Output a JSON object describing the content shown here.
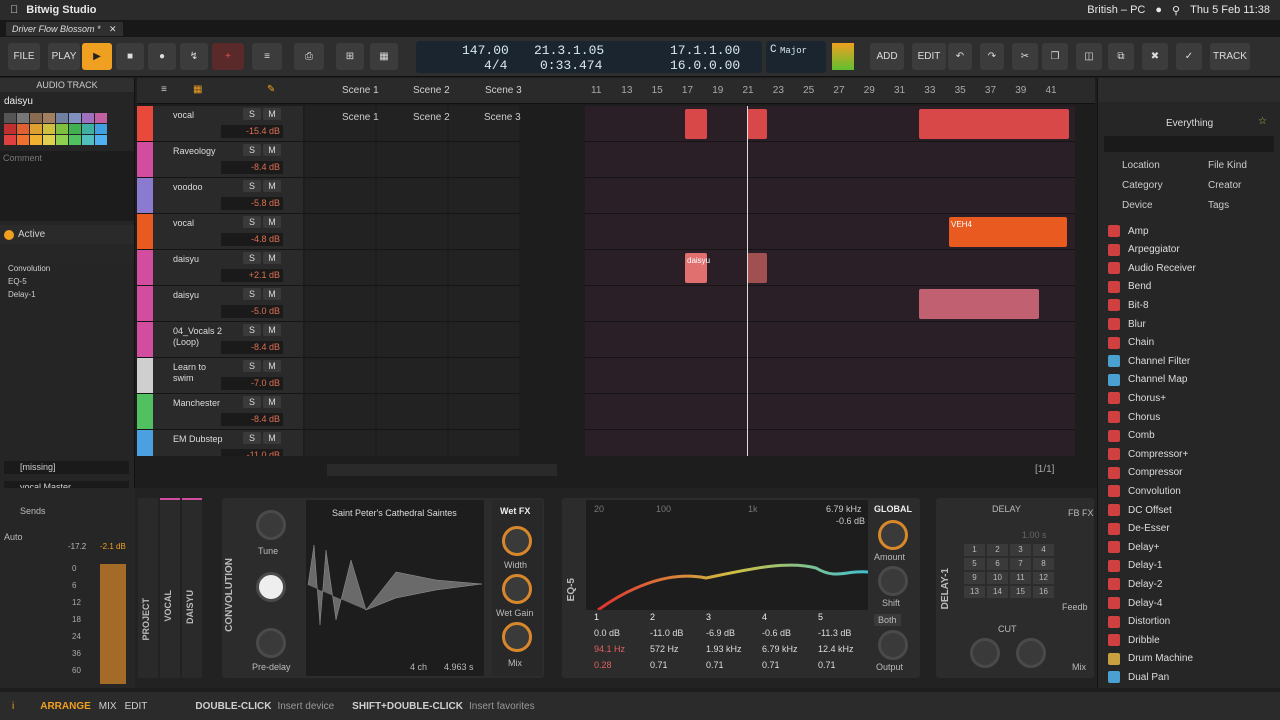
{
  "menubar": {
    "app": "Bitwig Studio",
    "keyboard": "British – PC",
    "clock": "Thu 5 Feb  11:38"
  },
  "tab": {
    "title": "Driver Flow Blossom *"
  },
  "transport": {
    "file": "FILE",
    "play": "PLAY",
    "tempo": "147.00",
    "signature": "4/4",
    "position": "21.3.1.05",
    "time": "0:33.474",
    "loop_start": "17.1.1.00",
    "loop_len": "16.0.0.00",
    "key": "C",
    "scale": "Major",
    "add": "ADD",
    "edit": "EDIT",
    "track": "TRACK"
  },
  "inspector": {
    "title": "AUDIO TRACK",
    "track_name": "daisyu",
    "comment": "Comment",
    "active": "Active",
    "devices": [
      "Convolution",
      "EQ-5",
      "Delay-1"
    ],
    "input": "[missing]",
    "output": "vocal Master",
    "sends": "Sends",
    "auto": "Auto",
    "fader_db": [
      "-17.2",
      "-2.1 dB"
    ],
    "meter_scale": [
      "0",
      "6",
      "12",
      "18",
      "24",
      "36",
      "60"
    ],
    "track_labels": [
      "PROJECT",
      "VOCAL",
      "DAISYU"
    ]
  },
  "scenes": [
    "Scene 1",
    "Scene 2",
    "Scene 3"
  ],
  "ruler": [
    "11",
    "13",
    "15",
    "17",
    "19",
    "21",
    "23",
    "25",
    "27",
    "29",
    "31",
    "33",
    "35",
    "37",
    "39",
    "41"
  ],
  "tracks": [
    {
      "name": "vocal",
      "db": "-15.4 dB",
      "color": "#e8493a"
    },
    {
      "name": "Raveology",
      "db": "-8.4 dB",
      "color": "#d24da0"
    },
    {
      "name": "voodoo",
      "db": "-5.8 dB",
      "color": "#8a7ad0"
    },
    {
      "name": "vocal",
      "db": "-4.8 dB",
      "color": "#e85a20"
    },
    {
      "name": "daisyu",
      "db": "+2.1 dB",
      "color": "#d24da0"
    },
    {
      "name": "daisyu",
      "db": "-5.0 dB",
      "color": "#d24da0"
    },
    {
      "name": "04_Vocals 2 (Loop)",
      "db": "-8.4 dB",
      "color": "#d24da0"
    },
    {
      "name": "Learn to swim",
      "db": "-7.0 dB",
      "color": "#cfcfcf"
    },
    {
      "name": "Manchester",
      "db": "-8.4 dB",
      "color": "#50c060"
    },
    {
      "name": "EM Dubstep",
      "db": "-11.0 dB",
      "color": "#4aa0e0"
    }
  ],
  "clip_labels": {
    "daisyu": "daisyu",
    "veh": "VEH4"
  },
  "pager": "[1/1]",
  "convolution": {
    "title": "CONVOLUTION",
    "ir": "Saint Peter's Cathedral Saintes",
    "tune": "Tune",
    "predelay": "Pre-delay",
    "channels": "4 ch",
    "length": "4.963 s",
    "wetfx": "Wet FX",
    "width": "Width",
    "wetgain": "Wet Gain",
    "mix": "Mix"
  },
  "eq": {
    "title": "EQ-5",
    "freq_labels": [
      "20",
      "100",
      "1k"
    ],
    "readout": [
      "6.79 kHz",
      "-0.6 dB"
    ],
    "global": "GLOBAL",
    "amount": "Amount",
    "shift": "Shift",
    "both": "Both",
    "output": "Output",
    "gains": [
      "0.0 dB",
      "-11.0 dB",
      "-6.9 dB",
      "-0.6 dB",
      "-11.3 dB"
    ],
    "freqs": [
      "94.1 Hz",
      "572 Hz",
      "1.93 kHz",
      "6.79 kHz",
      "12.4 kHz"
    ],
    "qs": [
      "0.28",
      "0.71",
      "0.71",
      "0.71",
      "0.71"
    ],
    "bands": [
      "1",
      "2",
      "3",
      "4",
      "5"
    ]
  },
  "delay": {
    "title": "DELAY-1",
    "label": "DELAY",
    "fb": "FB FX",
    "time": "1.00 s",
    "grid": [
      "1",
      "2",
      "3",
      "4",
      "5",
      "6",
      "7",
      "8",
      "9",
      "10",
      "11",
      "12",
      "13",
      "14",
      "15",
      "16"
    ],
    "cut": "CUT",
    "feedback": "Feedb",
    "mix": "Mix"
  },
  "browser": {
    "title": "Everything",
    "filters": [
      "Location",
      "File Kind",
      "Category",
      "Creator",
      "Device",
      "Tags"
    ],
    "items": [
      "Amp",
      "Arpeggiator",
      "Audio Receiver",
      "Bend",
      "Bit-8",
      "Blur",
      "Chain",
      "Channel Filter",
      "Channel Map",
      "Chorus+",
      "Chorus",
      "Comb",
      "Compressor+",
      "Compressor",
      "Convolution",
      "DC Offset",
      "De-Esser",
      "Delay+",
      "Delay-1",
      "Delay-2",
      "Delay-4",
      "Distortion",
      "Dribble",
      "Drum Machine",
      "Dual Pan"
    ]
  },
  "status": {
    "arrange": "ARRANGE",
    "mix": "MIX",
    "edit": "EDIT",
    "hint1_key": "DOUBLE-CLICK",
    "hint1": "Insert device",
    "hint2_key": "SHIFT+DOUBLE-CLICK",
    "hint2": "Insert favorites"
  },
  "colors": {
    "accent": "#f0a020",
    "record": "#c03030",
    "loop": "#3aa0e0"
  }
}
